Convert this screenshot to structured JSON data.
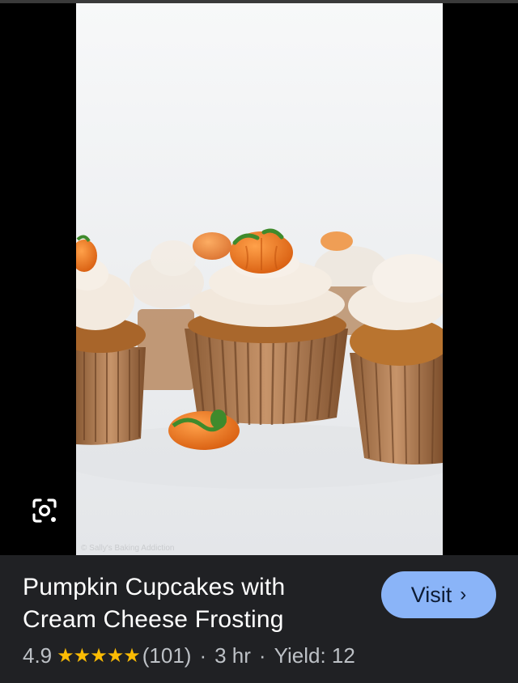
{
  "image": {
    "alt": "Pumpkin cupcakes with cream cheese frosting topped with candy pumpkins",
    "colors": {
      "background": "#eceef0",
      "frosting": "#f4ebe0",
      "cake": "#b5702f",
      "liner": "#b6845a",
      "pumpkin": "#e8741c",
      "stem": "#3f8a2c"
    }
  },
  "lens_button": {
    "icon": "lens-icon"
  },
  "result": {
    "title": "Pumpkin Cupcakes with Cream Cheese Frosting",
    "rating": "4.9",
    "rating_value": 4.9,
    "stars_max": 5,
    "stars_text": "★★★★★",
    "reviews": "(101)",
    "time": "3 hr",
    "yield": "Yield: 12",
    "separator": "·",
    "visit_label": "Visit",
    "visit_icon": "chevron-right-icon",
    "accent_color": "#8ab4f8",
    "star_color": "#fbbc04"
  }
}
